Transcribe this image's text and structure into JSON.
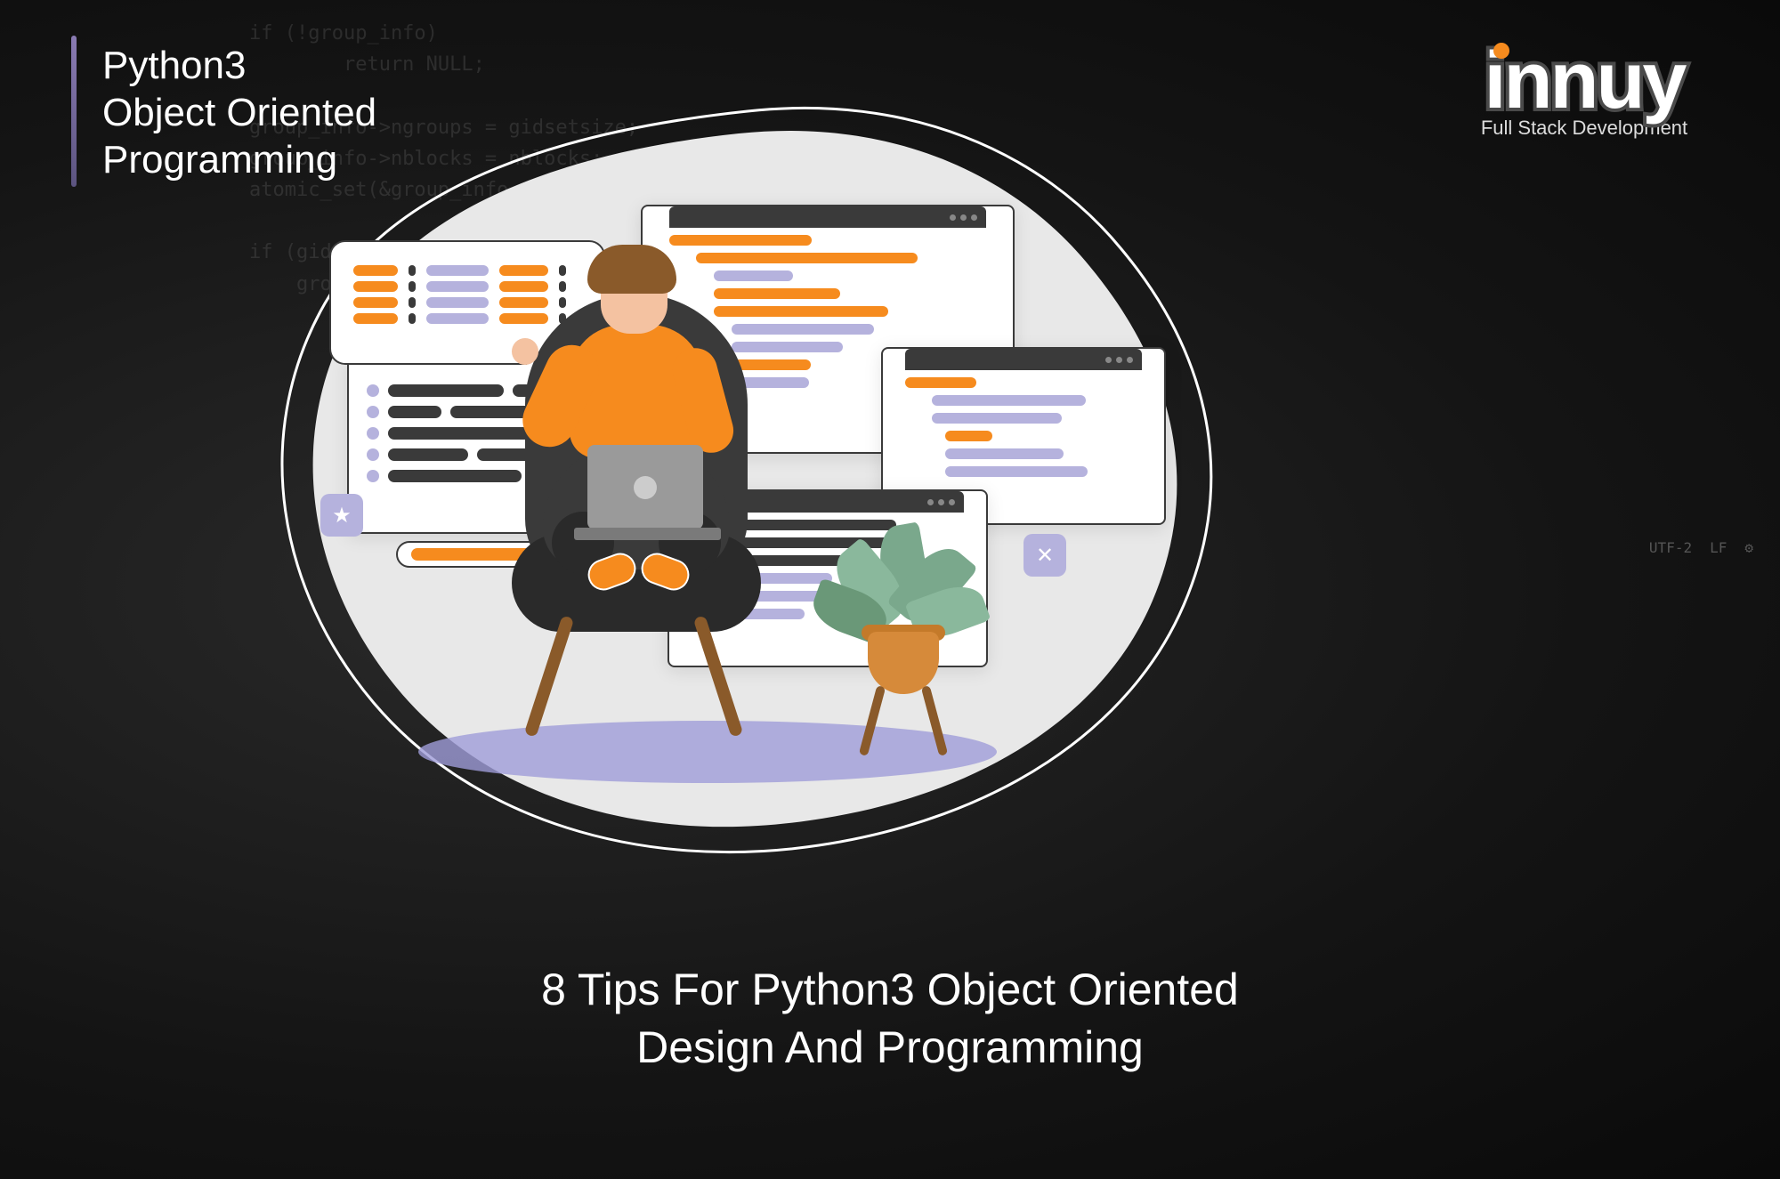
{
  "header": {
    "line1": "Python3",
    "line2": "Object Oriented",
    "line3": "Programming"
  },
  "logo": {
    "name": "innuy",
    "tagline": "Full Stack Development"
  },
  "title": {
    "line1": "8 Tips For Python3 Object Oriented",
    "line2": "Design And Programming"
  },
  "bg_code": "if (!group_info)\n        return NULL;\n\ngroup_info->ngroups = gidsetsize;\ngroup_info->nblocks = nblocks;\natomic_set(&group_info->usage\n\nif (gidsetsize <=\n    group_info",
  "status": {
    "encoding": "UTF-2",
    "line_ending": "LF"
  },
  "colors": {
    "accent_orange": "#f68b1e",
    "accent_lavender": "#b5b2dd",
    "dark": "#3a3a3a"
  }
}
